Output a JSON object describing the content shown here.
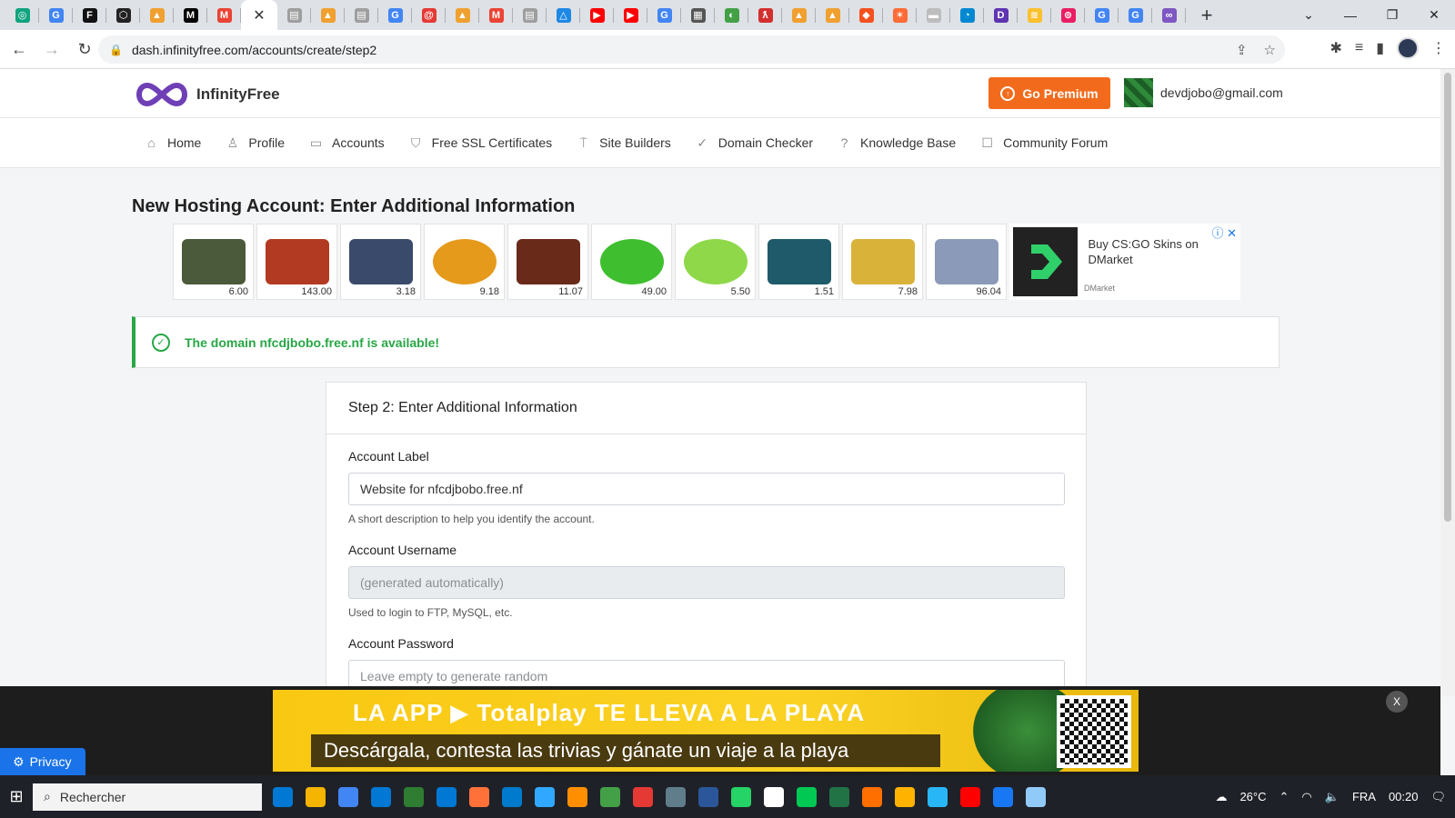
{
  "browser": {
    "tabs": [
      {
        "icon": "chatgpt-icon",
        "color": "#10a37f",
        "glyph": "◎"
      },
      {
        "icon": "google-icon",
        "color": "#4285f4",
        "glyph": "G"
      },
      {
        "icon": "figma-icon",
        "color": "#111111",
        "glyph": "F"
      },
      {
        "icon": "openai-icon",
        "color": "#222222",
        "glyph": "⬡"
      },
      {
        "icon": "pma-icon",
        "color": "#f0a030",
        "glyph": "▲"
      },
      {
        "icon": "medium-icon",
        "color": "#000000",
        "glyph": "M"
      },
      {
        "icon": "gmail-icon",
        "color": "#ea4335",
        "glyph": "M"
      },
      {
        "icon": "active-tab",
        "color": "#ffffff",
        "glyph": "✕",
        "active": true
      },
      {
        "icon": "doc-icon",
        "color": "#9e9e9e",
        "glyph": "▤"
      },
      {
        "icon": "pma-icon",
        "color": "#f0a030",
        "glyph": "▲"
      },
      {
        "icon": "doc-icon",
        "color": "#9e9e9e",
        "glyph": "▤"
      },
      {
        "icon": "google-icon",
        "color": "#4285f4",
        "glyph": "G"
      },
      {
        "icon": "swirl-icon",
        "color": "#e53935",
        "glyph": "@"
      },
      {
        "icon": "pma-icon",
        "color": "#f0a030",
        "glyph": "▲"
      },
      {
        "icon": "gmail-icon",
        "color": "#ea4335",
        "glyph": "M"
      },
      {
        "icon": "doc-icon",
        "color": "#9e9e9e",
        "glyph": "▤"
      },
      {
        "icon": "drive-icon",
        "color": "#1e88e5",
        "glyph": "△"
      },
      {
        "icon": "youtube-icon",
        "color": "#ff0000",
        "glyph": "▶"
      },
      {
        "icon": "youtube-icon",
        "color": "#ff0000",
        "glyph": "▶"
      },
      {
        "icon": "google-icon",
        "color": "#4285f4",
        "glyph": "G"
      },
      {
        "icon": "grid-icon",
        "color": "#555555",
        "glyph": "▦"
      },
      {
        "icon": "green-app-icon",
        "color": "#43a047",
        "glyph": "◐"
      },
      {
        "icon": "feather-icon",
        "color": "#d32f2f",
        "glyph": "ƛ"
      },
      {
        "icon": "pma-icon",
        "color": "#f0a030",
        "glyph": "▲"
      },
      {
        "icon": "pma-icon",
        "color": "#f0a030",
        "glyph": "▲"
      },
      {
        "icon": "git-icon",
        "color": "#f4511e",
        "glyph": "◆"
      },
      {
        "icon": "postman-icon",
        "color": "#ff6c37",
        "glyph": "✶"
      },
      {
        "icon": "doc-icon",
        "color": "#bdbdbd",
        "glyph": "▬"
      },
      {
        "icon": "edge-icon",
        "color": "#0288d1",
        "glyph": "◔"
      },
      {
        "icon": "purple-d-icon",
        "color": "#5e35b1",
        "glyph": "D"
      },
      {
        "icon": "rainbow-icon",
        "color": "#fbc02d",
        "glyph": "≋"
      },
      {
        "icon": "swirl-icon",
        "color": "#e91e63",
        "glyph": "⊚"
      },
      {
        "icon": "google-icon",
        "color": "#4285f4",
        "glyph": "G"
      },
      {
        "icon": "google-icon",
        "color": "#4285f4",
        "glyph": "G"
      },
      {
        "icon": "infinity-icon",
        "color": "#7e57c2",
        "glyph": "∞"
      }
    ],
    "new_tab": "+",
    "url": "dash.infinityfree.com/accounts/create/step2"
  },
  "site": {
    "brand": "InfinityFree",
    "premium_label": "Go Premium",
    "user_email": "devdjobo@gmail.com",
    "accent_color": "#f26b1d",
    "brand_color": "#6f3fb6"
  },
  "nav": [
    {
      "label": "Home",
      "icon": "home-icon",
      "glyph": "⌂"
    },
    {
      "label": "Profile",
      "icon": "user-icon",
      "glyph": "♙"
    },
    {
      "label": "Accounts",
      "icon": "accounts-icon",
      "glyph": "▭"
    },
    {
      "label": "Free SSL Certificates",
      "icon": "shield-icon",
      "glyph": "⛉"
    },
    {
      "label": "Site Builders",
      "icon": "paint-roller-icon",
      "glyph": "⍑"
    },
    {
      "label": "Domain Checker",
      "icon": "check-circle-icon",
      "glyph": "✓"
    },
    {
      "label": "Knowledge Base",
      "icon": "question-icon",
      "glyph": "?"
    },
    {
      "label": "Community Forum",
      "icon": "chat-icon",
      "glyph": "☐"
    }
  ],
  "page": {
    "title": "New Hosting Account: Enter Additional Information",
    "alert": "The domain nfcdjbobo.free.nf is available!",
    "alert_color": "#28a745",
    "card_title": "Step 2: Enter Additional Information",
    "fields": {
      "label": {
        "label": "Account Label",
        "value": "Website for nfcdjbobo.free.nf",
        "help": "A short description to help you identify the account."
      },
      "username": {
        "label": "Account Username",
        "placeholder": "(generated automatically)",
        "help": "Used to login to FTP, MySQL, etc."
      },
      "password": {
        "label": "Account Password",
        "placeholder": "Leave empty to generate random"
      }
    }
  },
  "ad_skins": [
    {
      "price": "6.00",
      "color": "#4a5a3a",
      "icon": "pistol-skin-icon"
    },
    {
      "price": "143.00",
      "color": "#b33a22",
      "icon": "rifle-skin-icon"
    },
    {
      "price": "3.18",
      "color": "#3a4a6a",
      "icon": "agent-skin-icon"
    },
    {
      "price": "9.18",
      "color": "#e59a1c",
      "icon": "halflife-sticker-icon"
    },
    {
      "price": "11.07",
      "color": "#6a2a1a",
      "icon": "ak-skin-icon"
    },
    {
      "price": "49.00",
      "color": "#3fbf2f",
      "icon": "marker-sticker-icon"
    },
    {
      "price": "5.50",
      "color": "#8fd84a",
      "icon": "skill-surf-sticker-icon"
    },
    {
      "price": "1.51",
      "color": "#1f5a6a",
      "icon": "mlg-sticker-icon"
    },
    {
      "price": "7.98",
      "color": "#d9b23a",
      "icon": "signature-sticker-icon"
    },
    {
      "price": "96.04",
      "color": "#8a9ab8",
      "icon": "knife-skin-icon"
    }
  ],
  "ad_card": {
    "text": "Buy CS:GO Skins on DMarket",
    "source": "DMarket"
  },
  "bottom_banner": {
    "headline": "LA APP ▶ Totalplay TE LLEVA A LA PLAYA",
    "subline": "Descárgala, contesta las trivias y gánate un viaje a la playa",
    "close": "X"
  },
  "privacy_label": "Privacy",
  "taskbar": {
    "search": "Rechercher",
    "apps": [
      "#0078d4",
      "#f4b400",
      "#4285f4",
      "#0078d4",
      "#2e7d32",
      "#0078d4",
      "#ff7139",
      "#007acc",
      "#31a8ff",
      "#ff8f00",
      "#43a047",
      "#e53935",
      "#607d8b",
      "#2b579a",
      "#25d366",
      "#ffffff",
      "#00c853",
      "#217346",
      "#ff6f00",
      "#ffb300",
      "#29b6f6",
      "#ff0000",
      "#1877f2",
      "#90caf9"
    ],
    "temperature": "26°C",
    "lang": "FRA",
    "time": "00:20"
  }
}
